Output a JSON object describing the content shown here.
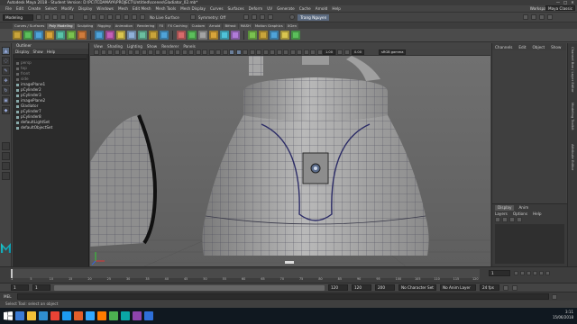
{
  "window": {
    "title": "Autodesk Maya 2018 - Student Version: D:\\PC\\TCDAMAYA\\PROJECT\\Untitled\\scenes\\Gladiator_02.mb*",
    "controls": [
      "—",
      "□",
      "✕"
    ]
  },
  "menubar": {
    "items": [
      "File",
      "Edit",
      "Create",
      "Select",
      "Modify",
      "Display",
      "Windows",
      "Mesh",
      "Edit Mesh",
      "Mesh Tools",
      "Mesh Display",
      "Curves",
      "Surfaces",
      "Deform",
      "UV",
      "Generate",
      "Cache",
      "Arnold",
      "Help"
    ],
    "workspace_label": "Workspace:",
    "workspace_value": "Maya Classic"
  },
  "statusline": {
    "mode": "Modeling",
    "no_live_surface": "No Live Surface",
    "symmetry": "Symmetry: Off",
    "user": "Trang Nguyen"
  },
  "shelf": {
    "tabs": [
      "Curves / Surfaces",
      "Poly Modeling",
      "Sculpting",
      "Rigging",
      "Animation",
      "Rendering",
      "FX",
      "FX Caching",
      "Custom",
      "Arnold",
      "Bifrost",
      "MASH",
      "Motion Graphics",
      "XGen"
    ],
    "active_tab": "Poly Modeling",
    "icon_colors": [
      "#c9a43a",
      "#5bbf5b",
      "#4fa3d9",
      "#d9a43a",
      "#59c3a8",
      "#7ac24f",
      "#d07b3b",
      "#4fa3d9",
      "#c45fb8",
      "#d9c54f",
      "#8fb0d9",
      "#6bbfa0",
      "#c9a43a",
      "#4fa3d9",
      "#d76b6b",
      "#5bbf5b",
      "#a3a3a3",
      "#d9a43a",
      "#4fc3d9",
      "#b07bd9",
      "#7ac24f",
      "#c9a43a",
      "#4fa3d9",
      "#d9c54f",
      "#5bbf5b"
    ]
  },
  "toolbox": {
    "tools": [
      "select-tool",
      "lasso-tool",
      "paint-select-tool",
      "move-tool",
      "rotate-tool",
      "scale-tool",
      "last-tool"
    ],
    "glyphs": [
      "▲",
      "◌",
      "✎",
      "✥",
      "↻",
      "▣",
      "◆"
    ]
  },
  "outliner": {
    "title": "Outliner",
    "menu": [
      "Display",
      "Show",
      "Help"
    ],
    "items": [
      {
        "label": "persp",
        "grey": true
      },
      {
        "label": "top",
        "grey": true
      },
      {
        "label": "front",
        "grey": true
      },
      {
        "label": "side",
        "grey": true
      },
      {
        "label": "imagePlane1",
        "grey": false
      },
      {
        "label": "pCylinder2",
        "grey": false
      },
      {
        "label": "pCylinder3",
        "grey": false
      },
      {
        "label": "imagePlane2",
        "grey": false
      },
      {
        "label": "Gladiator",
        "grey": false
      },
      {
        "label": "pCylinder7",
        "grey": false
      },
      {
        "label": "pCylinder8",
        "grey": false
      },
      {
        "label": "defaultLightSet",
        "grey": false
      },
      {
        "label": "defaultObjectSet",
        "grey": false
      }
    ]
  },
  "viewport": {
    "menu": [
      "View",
      "Shading",
      "Lighting",
      "Show",
      "Renderer",
      "Panels"
    ],
    "gamma_label": "sRGB gamma",
    "gamma_value": "0.00",
    "exposure_value": "1.00",
    "toolbar_icon_count": 38
  },
  "channelbox": {
    "menu": [
      "Channels",
      "Edit",
      "Object",
      "Show"
    ],
    "layer_tabs": [
      "Display",
      "Anim"
    ],
    "layer_menu": [
      "Layers",
      "Options",
      "Help"
    ]
  },
  "sidetabs": [
    "Channel Box / Layer Editor",
    "Modeling Toolkit",
    "Attribute Editor"
  ],
  "timeslider": {
    "ticks": [
      "1",
      "5",
      "10",
      "15",
      "20",
      "25",
      "30",
      "35",
      "40",
      "45",
      "50",
      "55",
      "60",
      "65",
      "70",
      "75",
      "80",
      "85",
      "90",
      "95",
      "100",
      "105",
      "110",
      "115",
      "120"
    ],
    "current_frame": "1"
  },
  "range": {
    "start": "1",
    "start_inner": "1",
    "end_inner": "120",
    "end": "120",
    "end_outer": "200",
    "character_set": "No Character Set",
    "anim_layer": "No Anim Layer",
    "fps": "24 fps"
  },
  "commandline": {
    "label": "MEL"
  },
  "helpline": {
    "text": "Select Tool: select an object"
  },
  "taskbar": {
    "icon_colors": [
      "#ffffff",
      "#3a7bd5",
      "#f2c037",
      "#2f8fd0",
      "#ea4335",
      "#1d9bf0",
      "#e25f2b",
      "#31a8ff",
      "#ff7c00",
      "#4caf50",
      "#0aa5a5",
      "#8e44ad",
      "#2e6fd8"
    ],
    "time": "3:11",
    "date": "15/06/2018"
  }
}
